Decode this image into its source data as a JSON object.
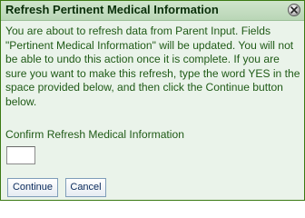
{
  "dialog": {
    "title": "Refresh Pertinent Medical Information",
    "close_icon": "close-icon",
    "message": "You are about to refresh data from Parent Input. Fields \"Pertinent Medical Information\" will be updated. You will not be able to undo this action once it is complete. If you are sure you want to make this refresh, type the word YES in the space provided below, and then click the Continue button below.",
    "confirm_label": "Confirm Refresh Medical Information",
    "confirm_value": "",
    "continue_label": "Continue",
    "cancel_label": "Cancel"
  },
  "colors": {
    "title_bar": "#c3ddc0",
    "body_background": "#eaf3ea",
    "text": "#1f5a16",
    "border": "#3c7a14"
  }
}
